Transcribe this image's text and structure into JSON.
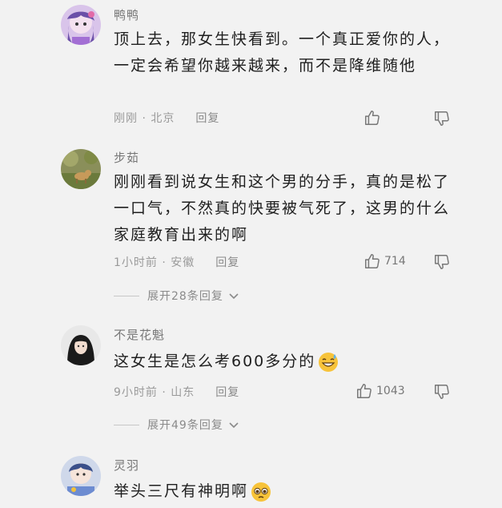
{
  "comments": [
    {
      "username": "鸭鸭",
      "content": "顶上去，那女生快看到。一个真正爱你的人，一定会希望你越来越来，而不是降维随他",
      "time_location": "刚刚 · 北京",
      "reply_label": "回复",
      "likes": ""
    },
    {
      "username": "步茹",
      "content": "刚刚看到说女生和这个男的分手，真的是松了一口气，不然真的快要被气死了，这男的什么家庭教育出来的啊",
      "time_location": "1小时前 · 安徽",
      "reply_label": "回复",
      "likes": "714",
      "expand_label": "展开28条回复"
    },
    {
      "username": "不是花魁",
      "content": "这女生是怎么考600多分的",
      "time_location": "9小时前 · 山东",
      "reply_label": "回复",
      "likes": "1043",
      "expand_label": "展开49条回复"
    },
    {
      "username": "灵羽",
      "content": "举头三尺有神明啊"
    }
  ],
  "icons": {
    "like": "thumbs-up-icon",
    "dislike": "thumbs-down-icon",
    "expand": "chevron-down-icon",
    "emoji_sweat": "sweat-smile-emoji",
    "emoji_pleading": "pleading-emoji"
  }
}
